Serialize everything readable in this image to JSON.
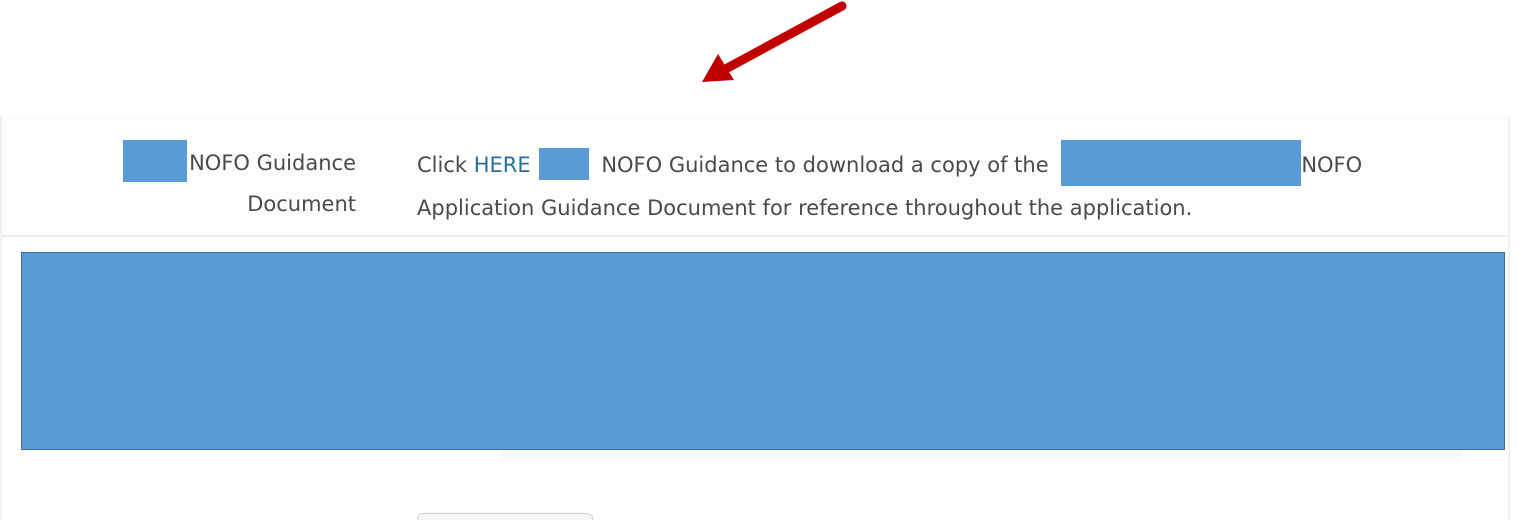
{
  "guidance_row": {
    "label_line1": "NOFO Guidance",
    "label_line2": "Document",
    "value_prefix": "Click ",
    "link_text": "HERE",
    "value_mid": " NOFO Guidance to download a copy of the ",
    "value_suffix": "NOFO",
    "value_line2": "Application Guidance Document for reference throughout the application."
  },
  "colors": {
    "redaction": "#5b9bd5",
    "link": "#2a6f97",
    "arrow": "#c00000",
    "text": "#4a4a4a"
  },
  "icons": {
    "annotation": "red-arrow-icon"
  }
}
